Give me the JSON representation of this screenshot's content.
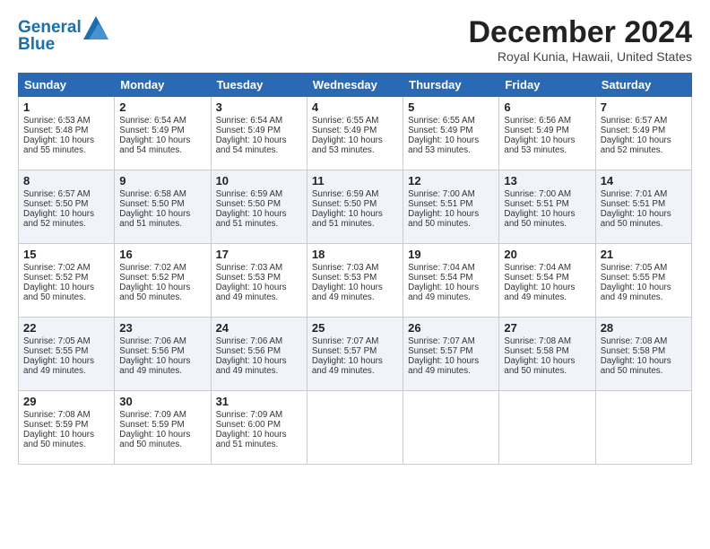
{
  "logo": {
    "line1": "General",
    "line2": "Blue"
  },
  "title": "December 2024",
  "subtitle": "Royal Kunia, Hawaii, United States",
  "headers": [
    "Sunday",
    "Monday",
    "Tuesday",
    "Wednesday",
    "Thursday",
    "Friday",
    "Saturday"
  ],
  "weeks": [
    [
      {
        "day": "1",
        "rise": "6:53 AM",
        "set": "5:48 PM",
        "daylight": "10 hours and 55 minutes"
      },
      {
        "day": "2",
        "rise": "6:54 AM",
        "set": "5:49 PM",
        "daylight": "10 hours and 54 minutes"
      },
      {
        "day": "3",
        "rise": "6:54 AM",
        "set": "5:49 PM",
        "daylight": "10 hours and 54 minutes"
      },
      {
        "day": "4",
        "rise": "6:55 AM",
        "set": "5:49 PM",
        "daylight": "10 hours and 53 minutes"
      },
      {
        "day": "5",
        "rise": "6:55 AM",
        "set": "5:49 PM",
        "daylight": "10 hours and 53 minutes"
      },
      {
        "day": "6",
        "rise": "6:56 AM",
        "set": "5:49 PM",
        "daylight": "10 hours and 53 minutes"
      },
      {
        "day": "7",
        "rise": "6:57 AM",
        "set": "5:49 PM",
        "daylight": "10 hours and 52 minutes"
      }
    ],
    [
      {
        "day": "8",
        "rise": "6:57 AM",
        "set": "5:50 PM",
        "daylight": "10 hours and 52 minutes"
      },
      {
        "day": "9",
        "rise": "6:58 AM",
        "set": "5:50 PM",
        "daylight": "10 hours and 51 minutes"
      },
      {
        "day": "10",
        "rise": "6:59 AM",
        "set": "5:50 PM",
        "daylight": "10 hours and 51 minutes"
      },
      {
        "day": "11",
        "rise": "6:59 AM",
        "set": "5:50 PM",
        "daylight": "10 hours and 51 minutes"
      },
      {
        "day": "12",
        "rise": "7:00 AM",
        "set": "5:51 PM",
        "daylight": "10 hours and 50 minutes"
      },
      {
        "day": "13",
        "rise": "7:00 AM",
        "set": "5:51 PM",
        "daylight": "10 hours and 50 minutes"
      },
      {
        "day": "14",
        "rise": "7:01 AM",
        "set": "5:51 PM",
        "daylight": "10 hours and 50 minutes"
      }
    ],
    [
      {
        "day": "15",
        "rise": "7:02 AM",
        "set": "5:52 PM",
        "daylight": "10 hours and 50 minutes"
      },
      {
        "day": "16",
        "rise": "7:02 AM",
        "set": "5:52 PM",
        "daylight": "10 hours and 50 minutes"
      },
      {
        "day": "17",
        "rise": "7:03 AM",
        "set": "5:53 PM",
        "daylight": "10 hours and 49 minutes"
      },
      {
        "day": "18",
        "rise": "7:03 AM",
        "set": "5:53 PM",
        "daylight": "10 hours and 49 minutes"
      },
      {
        "day": "19",
        "rise": "7:04 AM",
        "set": "5:54 PM",
        "daylight": "10 hours and 49 minutes"
      },
      {
        "day": "20",
        "rise": "7:04 AM",
        "set": "5:54 PM",
        "daylight": "10 hours and 49 minutes"
      },
      {
        "day": "21",
        "rise": "7:05 AM",
        "set": "5:55 PM",
        "daylight": "10 hours and 49 minutes"
      }
    ],
    [
      {
        "day": "22",
        "rise": "7:05 AM",
        "set": "5:55 PM",
        "daylight": "10 hours and 49 minutes"
      },
      {
        "day": "23",
        "rise": "7:06 AM",
        "set": "5:56 PM",
        "daylight": "10 hours and 49 minutes"
      },
      {
        "day": "24",
        "rise": "7:06 AM",
        "set": "5:56 PM",
        "daylight": "10 hours and 49 minutes"
      },
      {
        "day": "25",
        "rise": "7:07 AM",
        "set": "5:57 PM",
        "daylight": "10 hours and 49 minutes"
      },
      {
        "day": "26",
        "rise": "7:07 AM",
        "set": "5:57 PM",
        "daylight": "10 hours and 49 minutes"
      },
      {
        "day": "27",
        "rise": "7:08 AM",
        "set": "5:58 PM",
        "daylight": "10 hours and 50 minutes"
      },
      {
        "day": "28",
        "rise": "7:08 AM",
        "set": "5:58 PM",
        "daylight": "10 hours and 50 minutes"
      }
    ],
    [
      {
        "day": "29",
        "rise": "7:08 AM",
        "set": "5:59 PM",
        "daylight": "10 hours and 50 minutes"
      },
      {
        "day": "30",
        "rise": "7:09 AM",
        "set": "5:59 PM",
        "daylight": "10 hours and 50 minutes"
      },
      {
        "day": "31",
        "rise": "7:09 AM",
        "set": "6:00 PM",
        "daylight": "10 hours and 51 minutes"
      },
      null,
      null,
      null,
      null
    ]
  ],
  "labels": {
    "sunrise": "Sunrise:",
    "sunset": "Sunset:",
    "daylight": "Daylight:"
  }
}
